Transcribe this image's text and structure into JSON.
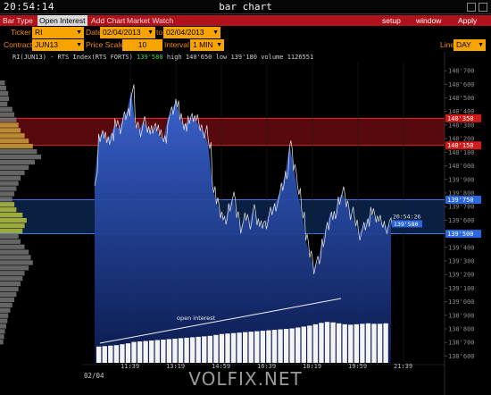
{
  "window": {
    "clock": "20:54:14",
    "title": "bar chart"
  },
  "menu": {
    "items": [
      "Bar Type",
      "Open Interest",
      "Add Chart",
      "Market Watch"
    ],
    "active_index": 1,
    "right_items": [
      "setup",
      "window",
      "Apply"
    ]
  },
  "controls": {
    "ticker_label": "Ticker",
    "ticker_value": "RI",
    "date_label": "Date",
    "date_from": "02/04/2013",
    "to_label": "to",
    "date_to": "02/04/2013",
    "contract_label": "Contract",
    "contract_value": "JUN13",
    "price_scale_label": "Price Scale",
    "price_scale_value": "10",
    "interval_label": "Interval",
    "interval_value": "1 MIN",
    "line_label": "Line",
    "line_value": "DAY"
  },
  "chart_header": {
    "instrument": "RI(JUN13) - RTS Index(RTS FORTS)",
    "last": "139'580",
    "high": "high 140'650",
    "low": "low 139'180",
    "volume": "volume 1126551"
  },
  "chart_data": {
    "type": "line",
    "title": "",
    "price_ticks": [
      "140'700",
      "140'600",
      "140'500",
      "140'400",
      "140'300",
      "140'200",
      "140'100",
      "140'000",
      "139'900",
      "139'800",
      "139'700",
      "139'600",
      "139'500",
      "139'400",
      "139'300",
      "139'200",
      "139'100",
      "139'000",
      "138'900",
      "138'800",
      "138'700",
      "138'600"
    ],
    "time_ticks": [
      "11:39",
      "13:19",
      "14:59",
      "16:39",
      "18:19",
      "19:59",
      "21:39"
    ],
    "date_label": "02/04",
    "ylim": [
      138550,
      140760
    ],
    "zones": [
      {
        "from": 140150,
        "to": 140350,
        "color": "#a0101a",
        "label_top": "140'350",
        "label_bottom": "140'150"
      },
      {
        "from": 139500,
        "to": 139750,
        "color": "#123b78",
        "label_top": "139'750",
        "label_bottom": "139'500"
      }
    ],
    "last_price": {
      "time": "20:54:26",
      "value": "139'580"
    },
    "price_series": [
      139900,
      140200,
      140250,
      140180,
      140230,
      140300,
      140270,
      140350,
      140400,
      140550,
      140300,
      140260,
      140330,
      140280,
      140250,
      140290,
      140220,
      140200,
      140350,
      140400,
      140480,
      140350,
      140300,
      140320,
      140360,
      140330,
      140280,
      140250,
      140150,
      139850,
      139730,
      139650,
      139580,
      139700,
      139760,
      139640,
      139550,
      139620,
      139580,
      139680,
      139600,
      139550,
      139570,
      139650,
      139700,
      139760,
      139840,
      139950,
      140150,
      140000,
      139800,
      139650,
      139450,
      139350,
      139250,
      139300,
      139450,
      139550,
      139650,
      139620,
      139750,
      139800,
      139720,
      139650,
      139580,
      139500,
      139550,
      139600,
      139650,
      139620,
      139590,
      139570,
      139550,
      139580
    ],
    "open_interest": {
      "label": "open interest",
      "values": [
        0.35,
        0.36,
        0.37,
        0.38,
        0.4,
        0.42,
        0.45,
        0.46,
        0.47,
        0.48,
        0.49,
        0.5,
        0.51,
        0.52,
        0.53,
        0.54,
        0.55,
        0.56,
        0.57,
        0.58,
        0.6,
        0.62,
        0.63,
        0.64,
        0.65,
        0.66,
        0.67,
        0.68,
        0.69,
        0.7,
        0.71,
        0.72,
        0.73,
        0.74,
        0.76,
        0.78,
        0.8,
        0.83,
        0.86,
        0.88,
        0.87,
        0.85,
        0.83,
        0.82,
        0.83,
        0.84,
        0.85,
        0.84,
        0.84,
        0.85
      ]
    },
    "volume_profile": [
      0.12,
      0.15,
      0.2,
      0.22,
      0.18,
      0.3,
      0.35,
      0.4,
      0.45,
      0.5,
      0.6,
      0.7,
      0.8,
      0.9,
      1.0,
      0.85,
      0.7,
      0.6,
      0.5,
      0.45,
      0.4,
      0.35,
      0.3,
      0.35,
      0.4,
      0.55,
      0.65,
      0.6,
      0.55,
      0.45,
      0.5,
      0.6,
      0.7,
      0.75,
      0.8,
      0.7,
      0.6,
      0.55,
      0.5,
      0.45,
      0.4,
      0.35,
      0.3,
      0.25,
      0.2,
      0.18,
      0.15,
      0.12,
      0.1,
      0.08
    ]
  },
  "colors": {
    "menu_bg": "#b0121b",
    "field_bg": "#f7a400",
    "price_fill": "#2e59c9",
    "red_zone": "#a0101a",
    "blue_zone": "#123b78"
  },
  "watermark": "VOLFIX.NET"
}
